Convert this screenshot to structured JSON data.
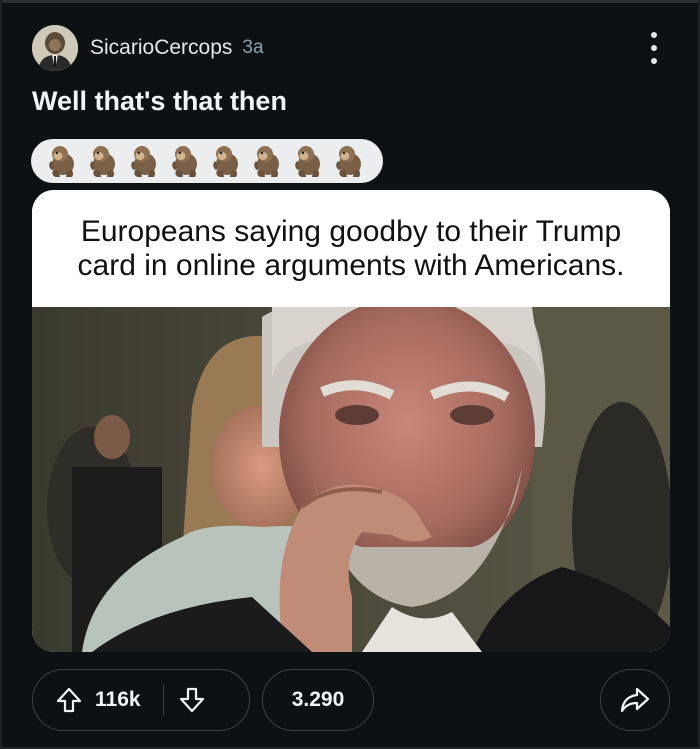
{
  "post": {
    "author": "SicarioCercops",
    "age": "3a",
    "title": "Well that's that then",
    "flair_icon_name": "monkey-emoji-icon",
    "flair_icon_count": 8,
    "meme_caption": "Europeans saying goodby to their Trump\ncard in online arguments with Americans."
  },
  "actions": {
    "upvotes": "116k",
    "comments": "3.290"
  },
  "colors": {
    "background": "#0e1113",
    "button_border": "#3a4146",
    "flair_bg": "#ebedee",
    "age_text": "#8ba2ad"
  }
}
